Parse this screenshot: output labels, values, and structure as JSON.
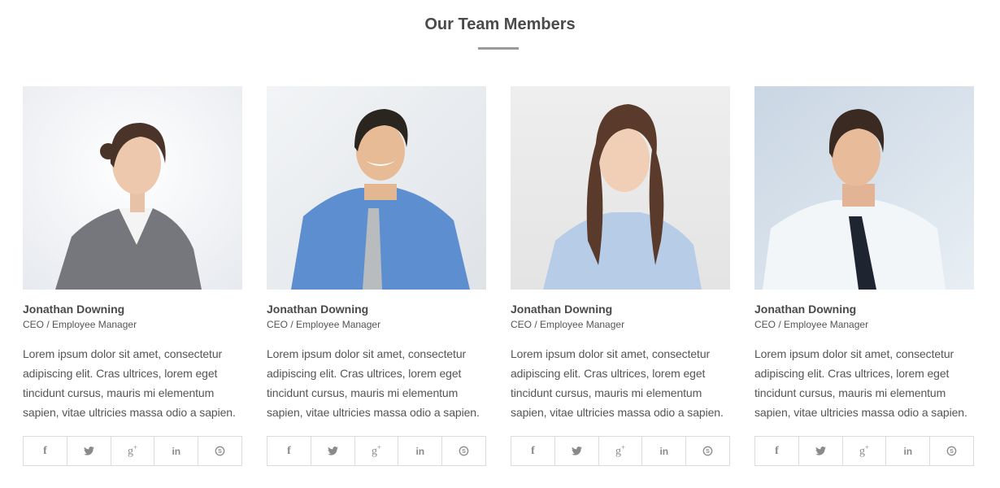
{
  "section": {
    "title": "Our Team Members"
  },
  "members": [
    {
      "name": "Jonathan Downing",
      "role": "CEO / Employee Manager",
      "bio": "Lorem ipsum dolor sit amet, consectetur adipiscing elit. Cras ultrices, lorem eget tincidunt cursus, mauris mi elementum sapien, vitae ultricies massa odio a sapien.",
      "photo": "portrait-woman-grey-blazer"
    },
    {
      "name": "Jonathan Downing",
      "role": "CEO / Employee Manager",
      "bio": "Lorem ipsum dolor sit amet, consectetur adipiscing elit. Cras ultrices, lorem eget tincidunt cursus, mauris mi elementum sapien, vitae ultricies massa odio a sapien.",
      "photo": "portrait-man-blue-shirt"
    },
    {
      "name": "Jonathan Downing",
      "role": "CEO / Employee Manager",
      "bio": "Lorem ipsum dolor sit amet, consectetur adipiscing elit. Cras ultrices, lorem eget tincidunt cursus, mauris mi elementum sapien, vitae ultricies massa odio a sapien.",
      "photo": "portrait-woman-light-blue-shirt"
    },
    {
      "name": "Jonathan Downing",
      "role": "CEO / Employee Manager",
      "bio": "Lorem ipsum dolor sit amet, consectetur adipiscing elit. Cras ultrices, lorem eget tincidunt cursus, mauris mi elementum sapien, vitae ultricies massa odio a sapien.",
      "photo": "portrait-man-dark-tie"
    }
  ],
  "social_icons": [
    "facebook-icon",
    "twitter-icon",
    "google-plus-icon",
    "linkedin-icon",
    "skype-icon"
  ],
  "colors": {
    "heading": "#4a4a4a",
    "text": "#555555",
    "icon": "#8a8a8a",
    "border": "#dcdcdc",
    "title_rule": "#9a9a9a"
  }
}
